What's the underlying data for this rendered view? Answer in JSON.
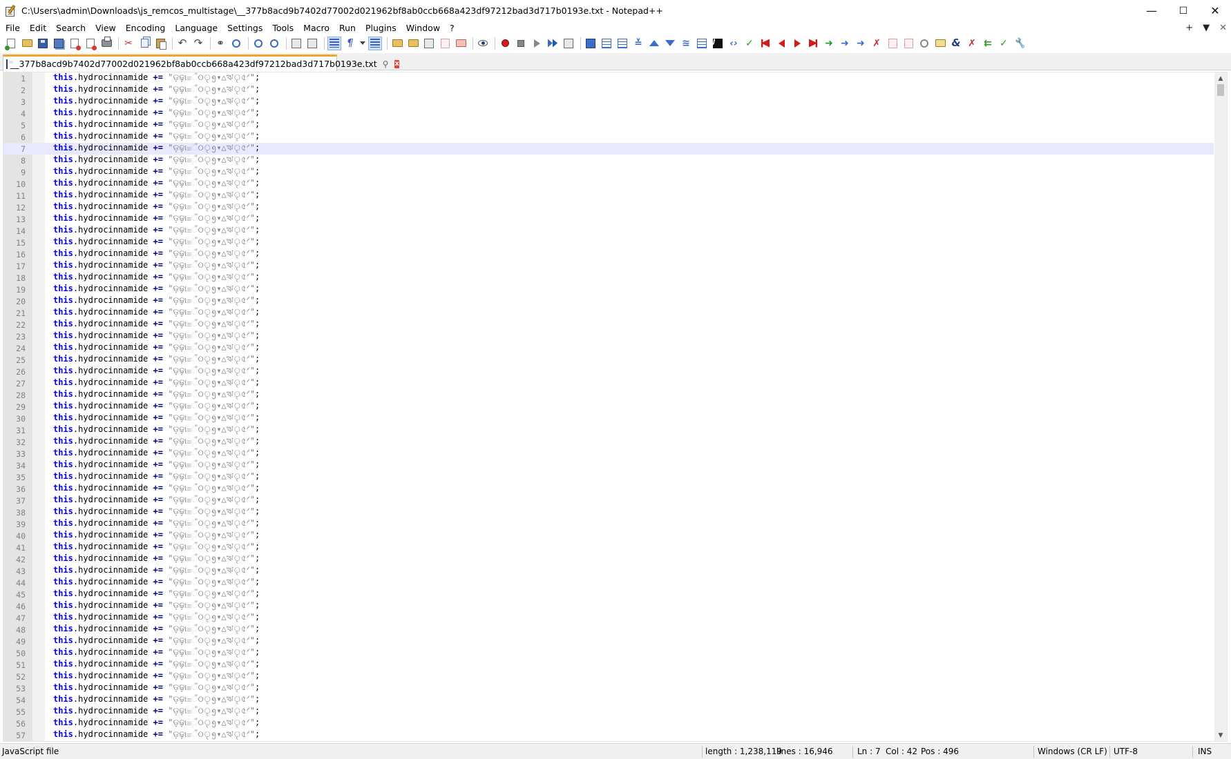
{
  "window": {
    "title": "C:\\Users\\admin\\Downloads\\js_remcos_multistage\\__377b8acd9b7402d77002d021962bf8ab0ccb668a423df97212bad3d717b0193e.txt - Notepad++",
    "minimize": "—",
    "maximize": "☐",
    "close": "✕"
  },
  "menu": {
    "items": [
      "File",
      "Edit",
      "Search",
      "View",
      "Encoding",
      "Language",
      "Settings",
      "Tools",
      "Macro",
      "Run",
      "Plugins",
      "Window",
      "?"
    ],
    "right": {
      "add": "+",
      "dropdown": "▼",
      "close": "✕"
    }
  },
  "tab": {
    "label": "__377b8acd9b7402d77002d021962bf8ab0ccb668a423df97212bad3d717b0193e.txt",
    "pin": "⚲",
    "close": "x"
  },
  "editor": {
    "first_line": 1,
    "visible_line_count": 57,
    "current_line": 7,
    "line_template": {
      "keyword": "this",
      "member": ".hydrocinnamide",
      "operator": "+=",
      "string": "\"ଡ଼ଢ଼ା≡ଁଠৃ᪅▾△ঋৃ৫ᐟ\"",
      "terminator": ";"
    }
  },
  "status": {
    "language": "JavaScript file",
    "length": "length : 1,238,119",
    "lines": "lines : 16,946",
    "ln": "Ln : 7",
    "col": "Col : 42",
    "pos": "Pos : 496",
    "eol": "Windows (CR LF)",
    "encoding": "UTF-8",
    "mode": "INS"
  },
  "colors": {
    "keyword": "#0000ff",
    "operator": "#000080",
    "string": "#808080",
    "current_line": "#e8e8ff",
    "tab_accent": "#f6a32e"
  }
}
